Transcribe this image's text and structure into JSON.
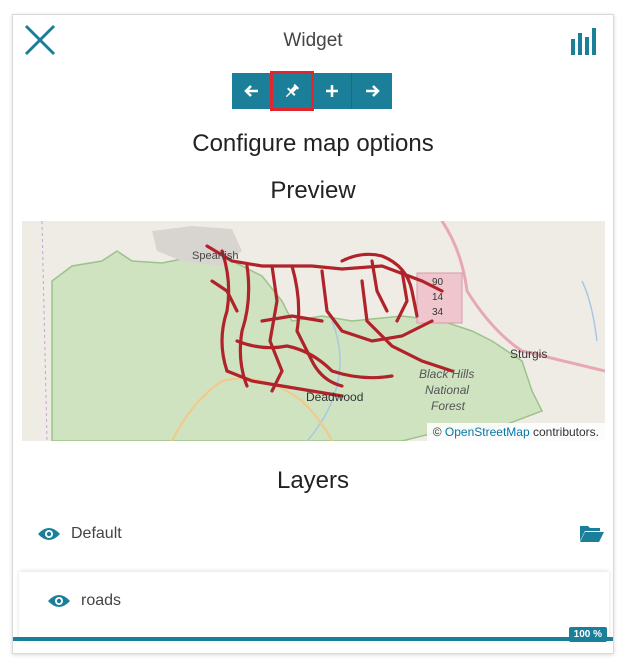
{
  "header": {
    "title": "Widget",
    "close_icon": "close-icon",
    "stats_icon": "bar-chart-icon"
  },
  "toolbar": {
    "buttons": [
      {
        "icon": "arrow-left-icon"
      },
      {
        "icon": "pushpin-icon",
        "active": true
      },
      {
        "icon": "plus-icon"
      },
      {
        "icon": "arrow-right-icon"
      }
    ]
  },
  "sections": {
    "configure": "Configure map options",
    "preview": "Preview",
    "layers": "Layers"
  },
  "map": {
    "labels": {
      "spearfish": "Spearfish",
      "sturgis": "Sturgis",
      "deadwood": "Deadwood",
      "forest_line1": "Black Hills",
      "forest_line2": "National",
      "forest_line3": "Forest",
      "hw1": "90",
      "hw2": "14",
      "hw3": "34"
    },
    "attribution": {
      "prefix": "©",
      "link": "OpenStreetMap",
      "suffix": "contributors."
    }
  },
  "layers": {
    "default": {
      "label": "Default",
      "icon": "eye-icon",
      "action_icon": "folder-open-icon"
    },
    "sublayer": {
      "label": "roads",
      "icon": "eye-icon"
    }
  },
  "progress": {
    "value": 100,
    "label": "100 %"
  },
  "colors": {
    "accent": "#1b7f99",
    "highlight": "#e0262f",
    "roads": "#b0232a",
    "forest": "#cfe3c1"
  }
}
